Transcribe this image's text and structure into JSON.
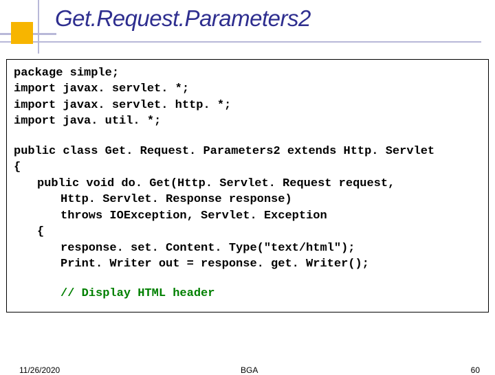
{
  "title": "Get.Request.Parameters2",
  "code": {
    "l1a": "package",
    "l1b": " simple;",
    "l2a": "import",
    "l2b": " javax. servlet. *;",
    "l3a": "import",
    "l3b": " javax. servlet. http. *;",
    "l4a": "import",
    "l4b": " java. util. *;",
    "l5a": "public class",
    "l5b": " Get. Request. Parameters2 ",
    "l5c": "extends",
    "l5d": " Http. Servlet",
    "l6": "{",
    "l7a": "public void",
    "l7b": " do. Get(Http. Servlet. Request request,",
    "l8": "Http. Servlet. Response response)",
    "l9a": "throws",
    "l9b": " IOException, Servlet. Exception",
    "l10": "{",
    "l11": "response. set. Content. Type(\"text/html\");",
    "l12": "Print. Writer out = response. get. Writer();",
    "l13": "// Display HTML header"
  },
  "footer": {
    "date": "11/26/2020",
    "center": "BGA",
    "page": "60"
  }
}
